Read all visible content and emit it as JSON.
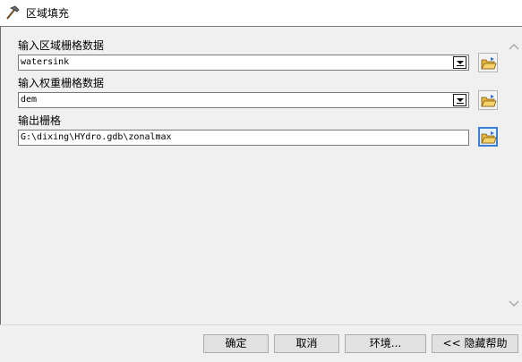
{
  "window": {
    "title": "区域填充",
    "icon": "hammer-icon"
  },
  "params": [
    {
      "label": "输入区域栅格数据",
      "value": "watersink",
      "kind": "dropdown"
    },
    {
      "label": "输入权重栅格数据",
      "value": "dem",
      "kind": "dropdown"
    },
    {
      "label": "输出栅格",
      "value": "G:\\dixing\\HYdro.gdb\\zonalmax",
      "kind": "text"
    }
  ],
  "footer": {
    "ok_label": "确定",
    "cancel_label": "取消",
    "env_label": "环境...",
    "help_label": "<< 隐藏帮助"
  },
  "colors": {
    "focus_border": "#3c7fd6",
    "folder_yellow": "#e8b83a"
  }
}
